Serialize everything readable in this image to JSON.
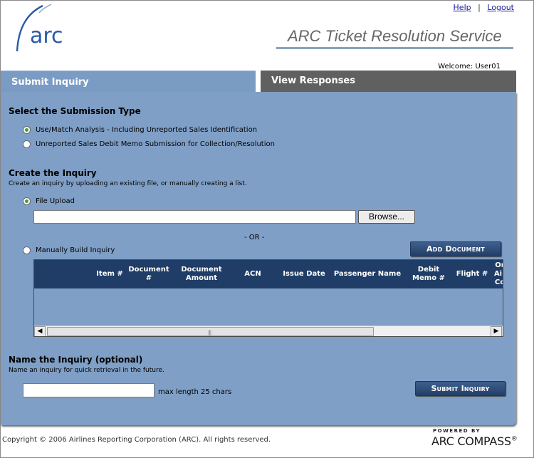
{
  "header": {
    "logo_text": "arc",
    "help_link": "Help",
    "separator": "|",
    "logout_link": "Logout",
    "app_title": "ARC Ticket Resolution Service",
    "welcome": "Welcome: User01"
  },
  "tabs": [
    {
      "label": "Submit Inquiry",
      "active": true
    },
    {
      "label": "View Responses",
      "active": false
    }
  ],
  "submission_type": {
    "title": "Select the Submission Type",
    "options": [
      {
        "label": "Use/Match Analysis - Including Unreported Sales Identification",
        "selected": true
      },
      {
        "label": "Unreported Sales Debit Memo Submission for Collection/Resolution",
        "selected": false
      }
    ]
  },
  "create_inquiry": {
    "title": "Create the Inquiry",
    "hint": "Create an inquiry by uploading an existing file, or manually creating a list.",
    "file_upload_label": "File Upload",
    "file_upload_value": "",
    "browse_label": "Browse...",
    "or_text": "- OR -",
    "manual_label": "Manually Build Inquiry",
    "add_document_label": "Add Document"
  },
  "grid": {
    "columns": [
      "Item #",
      "Document #",
      "Document Amount",
      "ACN",
      "Issue Date",
      "Passenger Name",
      "Debit Memo #",
      "Flight #",
      "Or Air Co"
    ]
  },
  "name_inquiry": {
    "title": "Name the Inquiry (optional)",
    "hint": "Name an inquiry for quick retrieval in the future.",
    "value": "",
    "max_length_text": "max length 25 chars",
    "submit_label": "Submit Inquiry"
  },
  "footer": {
    "copyright": "Copyright © 2006 Airlines Reporting Corporation (ARC). All rights reserved.",
    "powered_by": "POWERED BY",
    "brand": "ARC COMPASS",
    "trademark": "®"
  },
  "colors": {
    "panel": "#7f9fc6",
    "active_tab": "#7a9bc3",
    "inactive_tab": "#606060",
    "grid_header": "#1f3d66",
    "button": "#2f4f7c"
  }
}
